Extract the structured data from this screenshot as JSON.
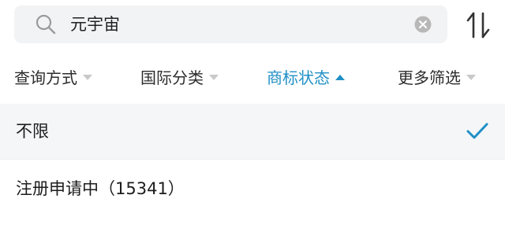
{
  "search": {
    "query": "元宇宙"
  },
  "icons": {
    "search": "search-icon",
    "clear": "clear-icon",
    "sort": "sort-icon",
    "dropdown": "triangle-down-icon",
    "dropdown_active": "triangle-up-icon",
    "check": "check-icon"
  },
  "filters": [
    {
      "label": "查询方式",
      "active": false
    },
    {
      "label": "国际分类",
      "active": false
    },
    {
      "label": "商标状态",
      "active": true
    },
    {
      "label": "更多筛选",
      "active": false
    }
  ],
  "options": [
    {
      "label": "不限",
      "selected": true
    },
    {
      "label": "注册申请中（15341）",
      "selected": false
    }
  ],
  "colors": {
    "accent": "#1f8fc6",
    "selected_row_bg": "#f5f6f8",
    "search_bg": "#f2f3f5"
  }
}
